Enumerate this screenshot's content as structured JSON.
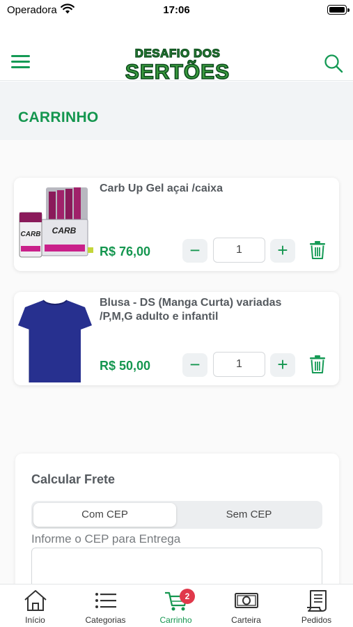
{
  "status_bar": {
    "carrier": "Operadora",
    "time": "17:06"
  },
  "header": {
    "logo_line1": "DESAFIO DOS",
    "logo_line2": "SERTÕES",
    "logo_alt": "Desafio dos Sertões",
    "menu_icon": "hamburger-menu-icon",
    "search_icon": "search-icon"
  },
  "page": {
    "title": "CARRINHO"
  },
  "cart": {
    "items": [
      {
        "name": "Carb Up Gel açai /caixa",
        "price": "R$ 76,00",
        "quantity": "1",
        "image": "carb-up-gel-box"
      },
      {
        "name": "Blusa - DS (Manga Curta) variadas /P,M,G adulto e infantil",
        "price": "R$ 50,00",
        "quantity": "1",
        "image": "blue-tshirt"
      }
    ],
    "minus_symbol": "−",
    "plus_symbol": "+"
  },
  "frete": {
    "title": "Calcular Frete",
    "options": [
      "Com CEP",
      "Sem CEP"
    ],
    "selected": "Com CEP",
    "cep_label": "Informe o CEP para Entrega",
    "cep_value": ""
  },
  "tab_bar": {
    "tabs": [
      {
        "label": "Início",
        "icon": "home-icon"
      },
      {
        "label": "Categorias",
        "icon": "list-icon"
      },
      {
        "label": "Carrinho",
        "icon": "cart-icon",
        "badge": "2"
      },
      {
        "label": "Carteira",
        "icon": "wallet-icon"
      },
      {
        "label": "Pedidos",
        "icon": "receipt-icon"
      }
    ],
    "active": "Carrinho"
  },
  "colors": {
    "brand_green": "#14964f",
    "badge_red": "#e0394b",
    "title_bar_bg": "#f2f4f6"
  }
}
